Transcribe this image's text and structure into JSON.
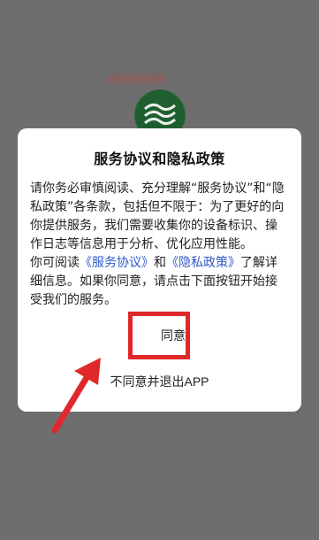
{
  "dialog": {
    "title": "服务协议和隐私政策",
    "paragraph1": "请你务必审慎阅读、充分理解“服务协议”和“隐私政策”各条款，包括但不限于：为了更好的向你提供服务，我们需要收集你的设备标识、操作日志等信息用于分析、优化应用性能。",
    "paragraph2_prefix": "你可阅读",
    "service_link": "《服务协议》",
    "conjunction": "和",
    "privacy_link": "《隐私政策》",
    "paragraph2_suffix": "了解详细信息。如果你同意，请点击下面按钮开始接受我们的服务。",
    "agree_label": "同意",
    "disagree_label": "不同意并退出APP"
  },
  "colors": {
    "overlay": "#6e6e6e",
    "highlight": "#e0282b",
    "link": "#2f59c8"
  },
  "icons": {
    "background_logo": "app-logo-icon",
    "annotation_arrow": "red-arrow-icon"
  }
}
